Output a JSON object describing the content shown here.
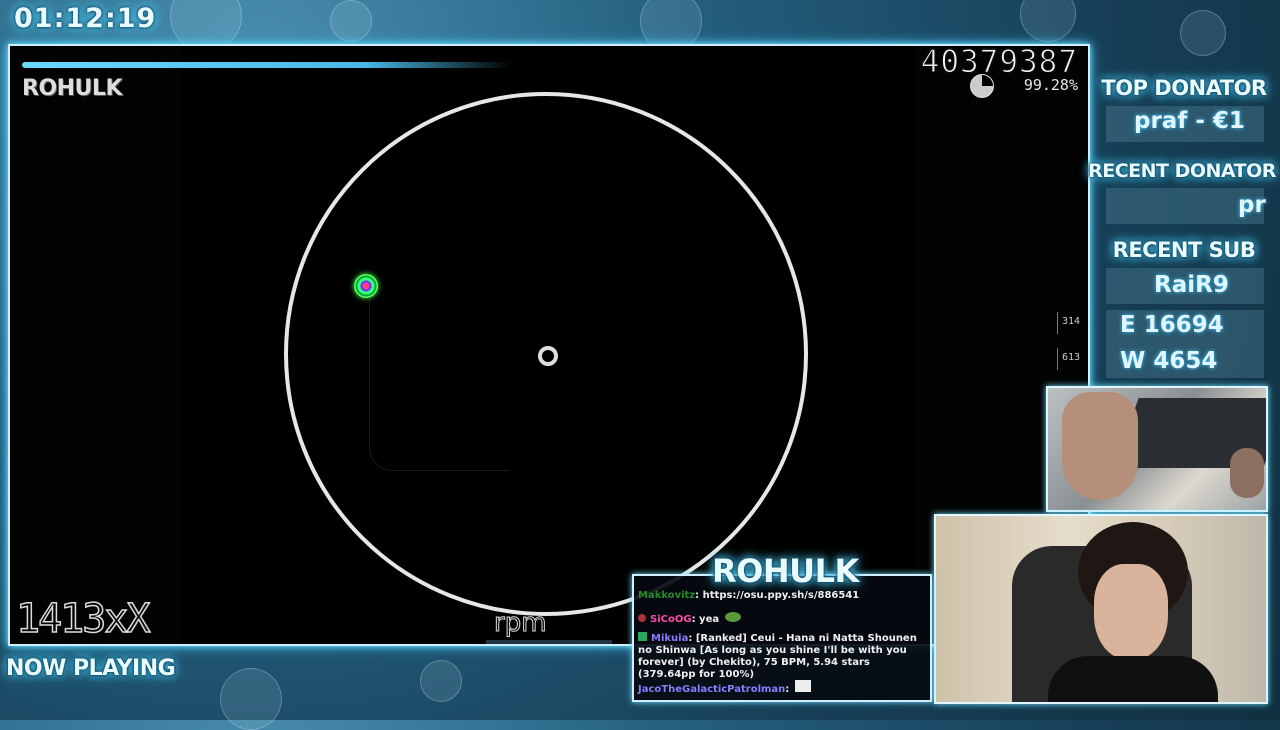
{
  "timer": "01:12:19",
  "game": {
    "player_name": "ROHULK",
    "score": "40379387",
    "accuracy": "99.28%",
    "hit_counts": [
      "314",
      "613"
    ],
    "combo": "1413x",
    "combo_ghost": "X",
    "spinner_label": "rpm"
  },
  "footer": {
    "now_playing": "NOW PLAYING"
  },
  "sidebar": {
    "top_donator_label": "TOP DONATOR",
    "top_donator_value": "praf - €1",
    "recent_donator_label": "RECENT DONATOR",
    "recent_donator_value": "pr",
    "recent_sub_label": "RECENT SUB",
    "recent_sub_value": "RaiR9",
    "stat_e": "E 16694",
    "stat_w": "W 4654"
  },
  "chat": {
    "title": "ROHULK",
    "messages": [
      {
        "user": "Makkovitz",
        "sep": ": ",
        "text": "https://osu.ppy.sh/s/886541",
        "color": "#2a8a2a"
      },
      {
        "user": "SiCoOG",
        "sep": ": ",
        "text": "yea",
        "color": "#ff4aa8"
      },
      {
        "user": "Mikuia",
        "sep": ": ",
        "text": "[Ranked] Ceui - Hana ni Natta Shounen no Shinwa [As long as you shine I'll be with you forever] (by Chekito), 75 BPM, 5.94 stars (379.64pp for 100%)",
        "color": "#8a7cff"
      },
      {
        "user": "JacoTheGalacticPatrolman",
        "sep": ": ",
        "text": "",
        "color": "#8a7cff"
      }
    ]
  },
  "colors": {
    "accent": "#4fd2ff",
    "frame": "#cfefff",
    "background": "#1c4f6b"
  }
}
